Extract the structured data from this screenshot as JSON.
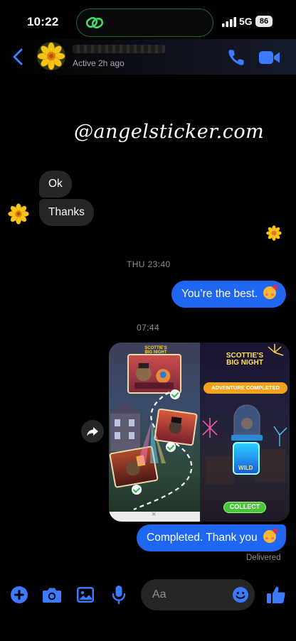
{
  "status_bar": {
    "time": "10:22",
    "network": "5G",
    "battery": "86"
  },
  "header": {
    "active_status": "Active 2h ago"
  },
  "watermark": "@angelsticker.com",
  "messages": {
    "incoming_ok": "Ok",
    "incoming_thanks": "Thanks",
    "timestamp_1": "THU 23:40",
    "outgoing_best": "You’re the best.",
    "timestamp_2": "07:44",
    "outgoing_completed": "Completed. Thank you",
    "delivered": "Delivered"
  },
  "image_message": {
    "banner": "ADVENTURE COMPLETED",
    "collect": "COLLECT",
    "logo_left": "SCOTTIE'S BIG NIGHT",
    "logo_right": "SCOTTIE'S BIG NIGHT",
    "wild_label": "WILD"
  },
  "composer": {
    "placeholder": "Aa"
  },
  "colors": {
    "accent": "#1f66f0",
    "icon_blue": "#3c7bff",
    "incoming_bubble": "#262628",
    "background": "#000000"
  }
}
